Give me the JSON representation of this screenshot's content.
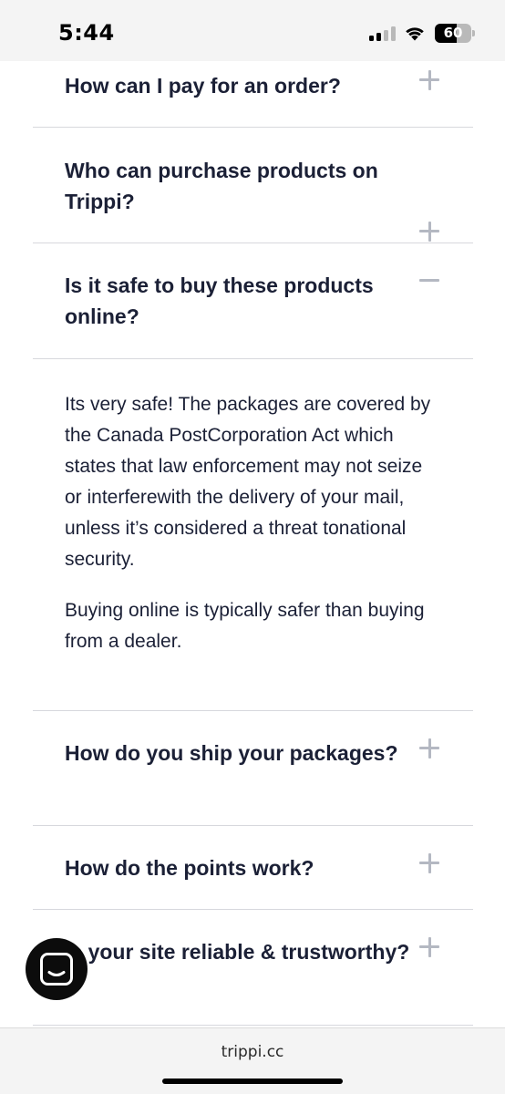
{
  "status_bar": {
    "time": "5:44",
    "battery": "60",
    "battery_level": 0.6
  },
  "faq": {
    "items": [
      {
        "question": "How can I pay for an order?",
        "state": "collapsed",
        "toggle_icon": "plus-icon"
      },
      {
        "question": "Who can purchase products on Trippi?",
        "state": "collapsed",
        "toggle_icon": "plus-icon"
      },
      {
        "question": "Is it safe to buy these products online?",
        "state": "expanded",
        "toggle_icon": "minus-icon",
        "answer": [
          "Its very safe! The packages are covered by the Canada PostCorporation Act which states that law enforcement may not seize or interferewith the delivery of your mail, unless it’s considered a threat tonational security.",
          "Buying online is typically safer than buying from a dealer."
        ]
      },
      {
        "question": "How do you ship your packages?",
        "state": "collapsed",
        "toggle_icon": "plus-icon"
      },
      {
        "question": "How do the points work?",
        "state": "collapsed",
        "toggle_icon": "plus-icon"
      },
      {
        "question": "Is your site reliable & trustworthy?",
        "state": "collapsed",
        "toggle_icon": "plus-icon"
      }
    ]
  },
  "chat_launcher": {
    "icon": "chat-smile-icon"
  },
  "browser": {
    "url": "trippi.cc"
  },
  "colors": {
    "text": "#1b2036",
    "divider": "#d7d8dd",
    "toggle": "#b4b8c2",
    "launcher": "#0c0c0c"
  }
}
